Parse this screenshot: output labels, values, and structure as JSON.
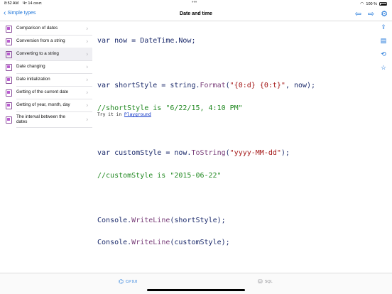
{
  "status": {
    "time": "8:52 AM",
    "date": "Чт 14 сент.",
    "battery": "100 %"
  },
  "nav": {
    "back_label": "Simple types",
    "title": "Date and time"
  },
  "sidebar": {
    "items": [
      {
        "label": "Comparison of dates"
      },
      {
        "label": "Conversion from a string"
      },
      {
        "label": "Converting to a string"
      },
      {
        "label": "Date changing"
      },
      {
        "label": "Date initialization"
      },
      {
        "label": "Getting of the current date"
      },
      {
        "label": "Getting of year, month, day"
      },
      {
        "label": "The interval between the dates"
      }
    ],
    "selected_index": 2
  },
  "code": {
    "l1_a": "var now = DateTime.Now;",
    "l2_a": "var shortStyle = string.",
    "l2_b": "Format",
    "l2_c": "(",
    "l2_d": "\"{0:d} {0:t}\"",
    "l2_e": ", now);",
    "l3": "//shortStyle is \"6/22/15, 4:10 PM\"",
    "l4_a": "var customStyle = now.",
    "l4_b": "ToString",
    "l4_c": "(",
    "l4_d": "\"yyyy-MM-dd\"",
    "l4_e": ");",
    "l5": "//customStyle is \"2015-06-22\"",
    "l6_a": "Console.",
    "l6_b": "WriteLine",
    "l6_c": "(shortStyle);",
    "l7_a": "Console.",
    "l7_b": "WriteLine",
    "l7_c": "(customStyle);"
  },
  "try_it": {
    "prefix": "Try it in ",
    "link": "Playground"
  },
  "tabs": [
    {
      "label": "C# 9.0",
      "active": true
    },
    {
      "label": "SQL",
      "active": false
    }
  ],
  "colors": {
    "accent": "#1a73d9",
    "string": "#a31515",
    "comment": "#238a23",
    "method": "#7a3f7a",
    "icon": "#b95bcf"
  }
}
